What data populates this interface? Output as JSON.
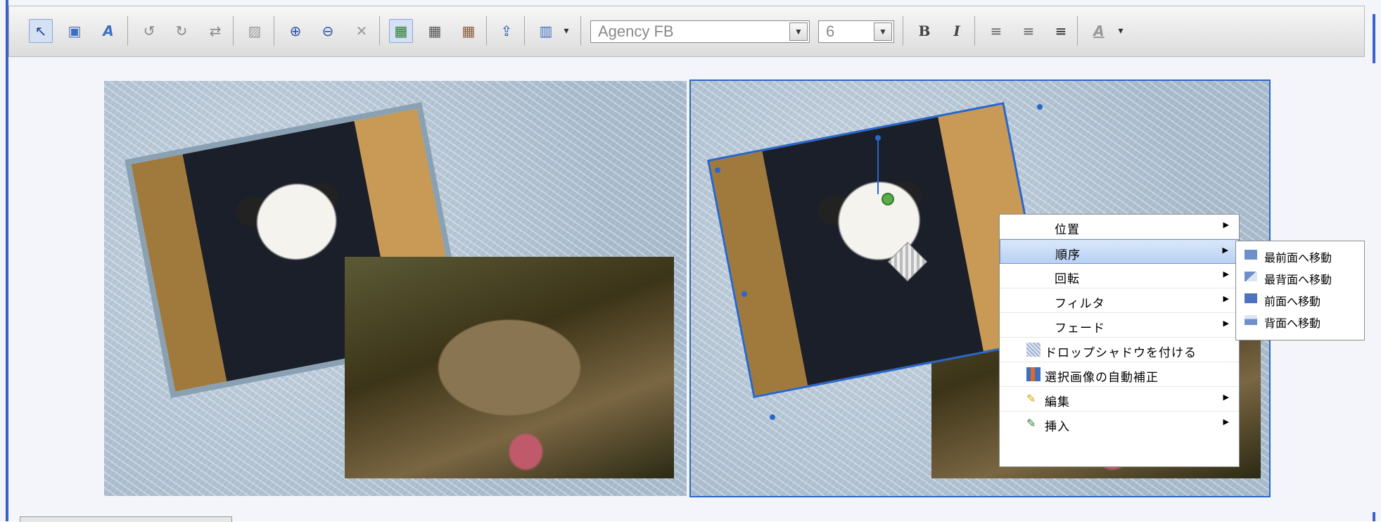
{
  "toolbar": {
    "font_name": "Agency FB",
    "font_size": "6",
    "bold_label": "B",
    "italic_label": "I",
    "font_color_label": "A",
    "buttons": [
      {
        "name": "select-icon",
        "glyph": "↖"
      },
      {
        "name": "add-image-icon",
        "glyph": "▣"
      },
      {
        "name": "add-text-icon",
        "glyph": "A"
      },
      {
        "name": "rotate-left-icon",
        "glyph": "↺"
      },
      {
        "name": "rotate-right-icon",
        "glyph": "↻"
      },
      {
        "name": "flip-icon",
        "glyph": "⇄"
      },
      {
        "name": "drop-shadow-icon",
        "glyph": "▨"
      },
      {
        "name": "zoom-in-icon",
        "glyph": "⊕"
      },
      {
        "name": "zoom-out-icon",
        "glyph": "⊖"
      },
      {
        "name": "fit-icon",
        "glyph": "✕"
      },
      {
        "name": "frame-image-icon",
        "glyph": "▦"
      },
      {
        "name": "image-dark-icon",
        "glyph": "▦"
      },
      {
        "name": "image-brown-icon",
        "glyph": "▦"
      },
      {
        "name": "import-image-icon",
        "glyph": "⇪"
      },
      {
        "name": "auto-correct-icon",
        "glyph": "▥"
      }
    ],
    "dropdown_arrow": "▾"
  },
  "context_menu": {
    "items": [
      {
        "label": "位置",
        "has_submenu": true
      },
      {
        "label": "順序",
        "has_submenu": true,
        "highlighted": true
      },
      {
        "label": "回転",
        "has_submenu": true
      },
      {
        "label": "フィルタ",
        "has_submenu": true
      },
      {
        "label": "フェード",
        "has_submenu": true
      },
      {
        "label": "ドロップシャドウを付ける",
        "icon": "drop-shadow-icon"
      },
      {
        "label": "選択画像の自動補正",
        "icon": "auto-correct-icon"
      },
      {
        "label": "編集",
        "icon": "pencil-icon",
        "has_submenu": true
      },
      {
        "label": "挿入",
        "icon": "insert-icon",
        "has_submenu": true
      }
    ],
    "submenu_arrow": "▶"
  },
  "order_submenu": {
    "items": [
      {
        "label": "最前面へ移動"
      },
      {
        "label": "最背面へ移動"
      },
      {
        "label": "前面へ移動"
      },
      {
        "label": "背面へ移動"
      }
    ]
  },
  "colors": {
    "accent": "#2a66c9",
    "menu_highlight": "#b9d1f4"
  }
}
